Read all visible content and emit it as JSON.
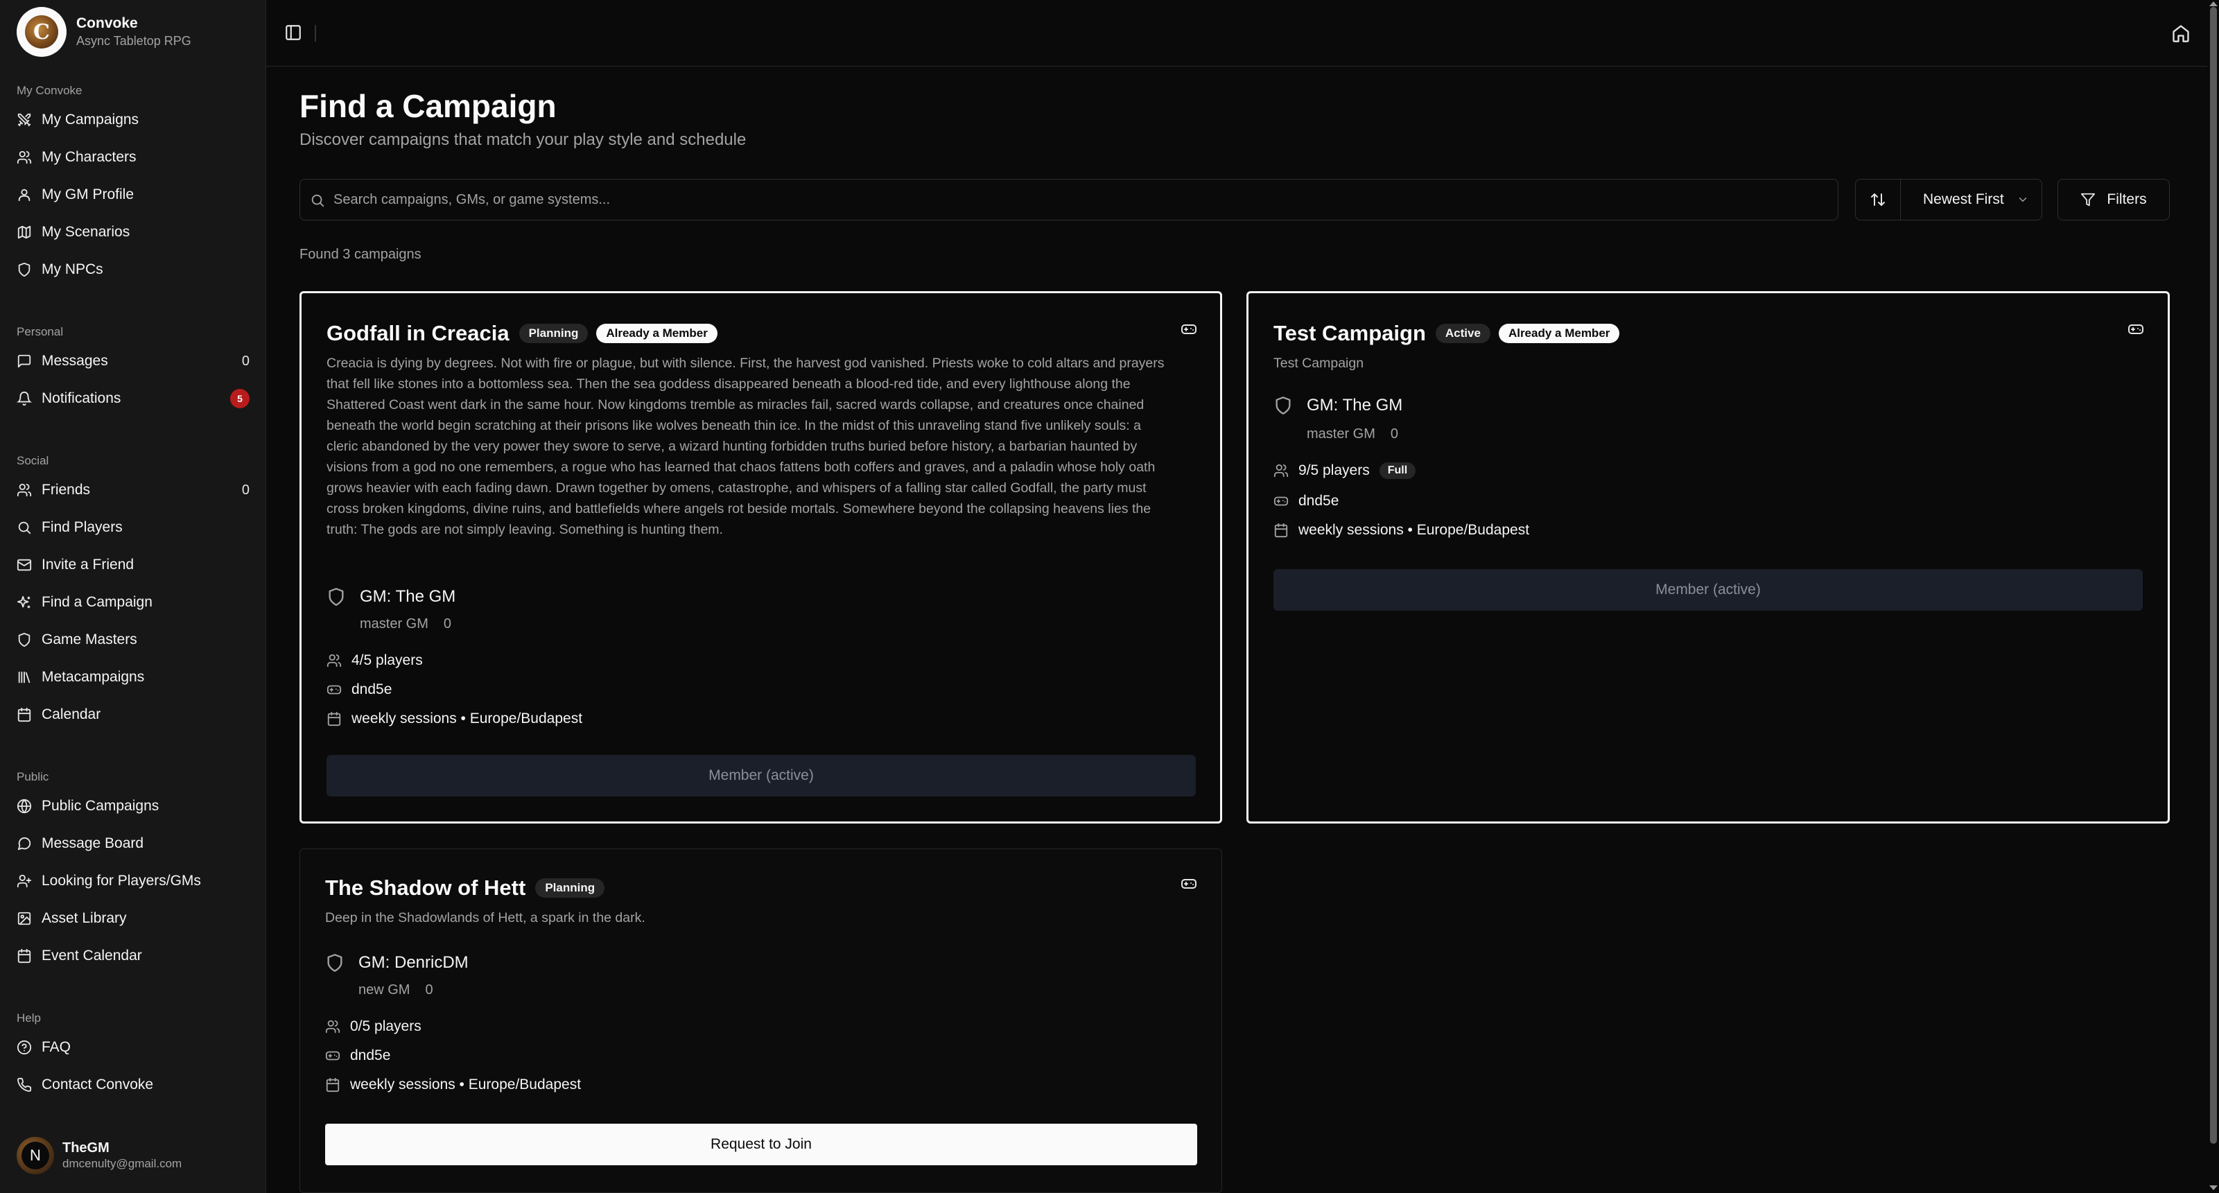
{
  "brand": {
    "name": "Convoke",
    "tagline": "Async Tabletop RPG",
    "logo_letter": "C"
  },
  "sidebar": {
    "sections": [
      {
        "heading": "My Convoke",
        "items": [
          {
            "label": "My Campaigns",
            "icon": "swords-icon"
          },
          {
            "label": "My Characters",
            "icon": "users-icon"
          },
          {
            "label": "My GM Profile",
            "icon": "user-icon"
          },
          {
            "label": "My Scenarios",
            "icon": "map-icon"
          },
          {
            "label": "My NPCs",
            "icon": "shield-icon"
          }
        ]
      },
      {
        "heading": "Personal",
        "items": [
          {
            "label": "Messages",
            "icon": "message-icon",
            "count": "0"
          },
          {
            "label": "Notifications",
            "icon": "bell-icon",
            "badge": "5"
          }
        ]
      },
      {
        "heading": "Social",
        "items": [
          {
            "label": "Friends",
            "icon": "users-icon",
            "count": "0"
          },
          {
            "label": "Find Players",
            "icon": "search-icon"
          },
          {
            "label": "Invite a Friend",
            "icon": "mail-icon"
          },
          {
            "label": "Find a Campaign",
            "icon": "sparkles-icon"
          },
          {
            "label": "Game Masters",
            "icon": "shield-icon"
          },
          {
            "label": "Metacampaigns",
            "icon": "library-icon"
          },
          {
            "label": "Calendar",
            "icon": "calendar-icon"
          }
        ]
      },
      {
        "heading": "Public",
        "items": [
          {
            "label": "Public Campaigns",
            "icon": "globe-icon"
          },
          {
            "label": "Message Board",
            "icon": "message-icon"
          },
          {
            "label": "Looking for Players/GMs",
            "icon": "user-plus-icon"
          },
          {
            "label": "Asset Library",
            "icon": "image-icon"
          },
          {
            "label": "Event Calendar",
            "icon": "calendar-icon"
          }
        ]
      },
      {
        "heading": "Help",
        "items": [
          {
            "label": "FAQ",
            "icon": "help-icon"
          },
          {
            "label": "Contact Convoke",
            "icon": "phone-icon"
          }
        ]
      }
    ]
  },
  "user": {
    "name": "TheGM",
    "email": "dmcenulty@gmail.com",
    "avatar_letter": "N"
  },
  "main": {
    "title": "Find a Campaign",
    "subtitle": "Discover campaigns that match your play style and schedule",
    "search_placeholder": "Search campaigns, GMs, or game systems...",
    "sort_value": "Newest First",
    "filters_label": "Filters",
    "found_text": "Found 3 campaigns"
  },
  "campaigns": [
    {
      "title": "Godfall in Creacia",
      "status": "Planning",
      "membership": "Already a Member",
      "description": "Creacia is dying by degrees. Not with fire or plague, but with silence. First, the harvest god vanished. Priests woke to cold altars and prayers that fell like stones into a bottomless sea. Then the sea goddess disappeared beneath a blood-red tide, and every lighthouse along the Shattered Coast went dark in the same hour. Now kingdoms tremble as miracles fail, sacred wards collapse, and creatures once chained beneath the world begin scratching at their prisons like wolves beneath thin ice. In the midst of this unraveling stand five unlikely souls: a cleric abandoned by the very power they swore to serve, a wizard hunting forbidden truths buried before history, a barbarian haunted by visions from a god no one remembers, a rogue who has learned that chaos fattens both coffers and graves, and a paladin whose holy oath grows heavier with each fading dawn. Drawn together by omens, catastrophe, and whispers of a falling star called Godfall, the party must cross broken kingdoms, divine ruins, and battlefields where angels rot beside mortals. Somewhere beyond the collapsing heavens lies the truth: The gods are not simply leaving. Something is hunting them.",
      "gm": "GM: The GM",
      "gm_title": "master GM",
      "gm_count": "0",
      "players": "4/5 players",
      "system": "dnd5e",
      "schedule": "weekly sessions • Europe/Budapest",
      "action": "Member (active)"
    },
    {
      "title": "Test Campaign",
      "status": "Active",
      "membership": "Already a Member",
      "description": "Test Campaign",
      "gm": "GM: The GM",
      "gm_title": "master GM",
      "gm_count": "0",
      "players": "9/5 players",
      "players_badge": "Full",
      "system": "dnd5e",
      "schedule": "weekly sessions • Europe/Budapest",
      "action": "Member (active)"
    },
    {
      "title": "The Shadow of Hett",
      "status": "Planning",
      "description": "Deep in the Shadowlands of Hett, a spark in the dark.",
      "gm": "GM: DenricDM",
      "gm_title": "new GM",
      "gm_count": "0",
      "players": "0/5 players",
      "system": "dnd5e",
      "schedule": "weekly sessions • Europe/Budapest",
      "action": "Request to Join"
    }
  ]
}
